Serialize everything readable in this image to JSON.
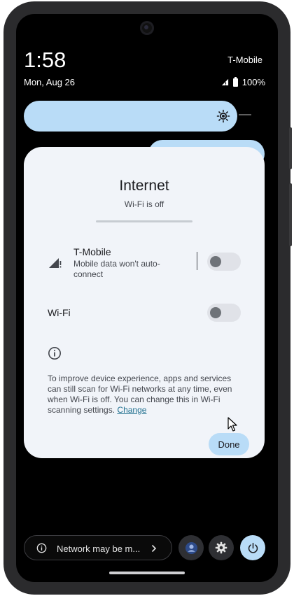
{
  "status_bar": {
    "time": "1:58",
    "date": "Mon, Aug 26",
    "carrier": "T-Mobile",
    "battery": "100%"
  },
  "dialog": {
    "title": "Internet",
    "subtitle": "Wi-Fi is off",
    "mobile_network": {
      "name": "T-Mobile",
      "summary": "Mobile data won't auto-connect",
      "enabled": false
    },
    "wifi": {
      "label": "Wi-Fi",
      "enabled": false
    },
    "info_text": "To improve device experience, apps and services can still scan for Wi-Fi networks at any time, even when Wi-Fi is off. You can change this in Wi-Fi scanning settings.",
    "info_link": "Change",
    "done_label": "Done"
  },
  "footer": {
    "security_text": "Network may be m..."
  },
  "colors": {
    "accent": "#b9dcf7",
    "dialog_bg": "#f1f4f9",
    "screen_bg": "#000000",
    "link": "#1f6f8f"
  },
  "icons": {
    "brightness": "brightness-sun-icon",
    "signal": "signal-no-data-icon",
    "info": "info-icon",
    "chevron": "chevron-right-icon",
    "user": "user-avatar-icon",
    "settings": "gear-icon",
    "power": "power-icon"
  }
}
